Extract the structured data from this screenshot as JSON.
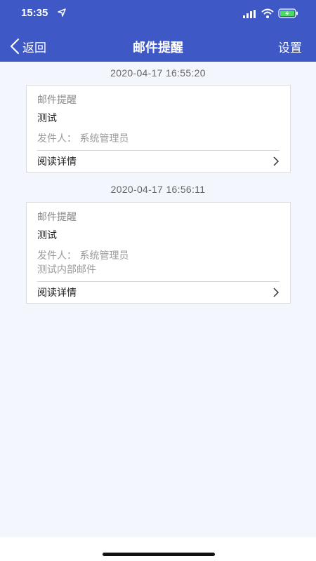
{
  "status_bar": {
    "time": "15:35",
    "icons": [
      "location-icon",
      "signal-icon",
      "wifi-icon",
      "battery-charging-icon"
    ]
  },
  "nav": {
    "back_label": "返回",
    "title": "邮件提醒",
    "settings_label": "设置"
  },
  "colors": {
    "header_bg": "#3e59c5",
    "page_bg": "#f3f6fd"
  },
  "messages": [
    {
      "timestamp": "2020-04-17 16:55:20",
      "title": "邮件提醒",
      "subject": "测试",
      "sender": "发件人：  系统管理员",
      "body": "",
      "link_label": "阅读详情"
    },
    {
      "timestamp": "2020-04-17 16:56:11",
      "title": "邮件提醒",
      "subject": "测试",
      "sender": "发件人：  系统管理员",
      "body": "测试内部邮件",
      "link_label": "阅读详情"
    }
  ]
}
